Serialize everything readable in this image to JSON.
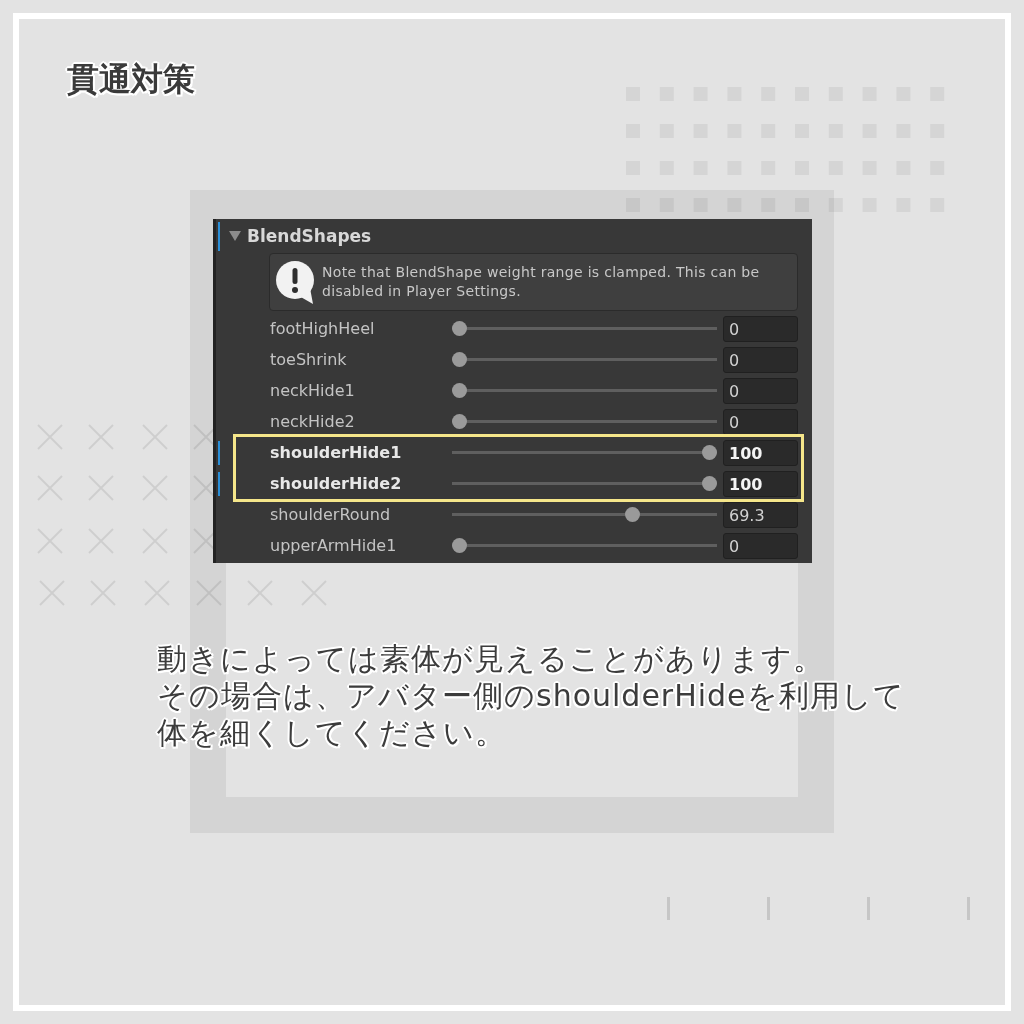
{
  "title": "貫通対策",
  "section": {
    "title": "BlendShapes",
    "expanded": true,
    "overridden": true,
    "notice": "Note that BlendShape weight range is clamped. This can be disabled in Player Settings.",
    "blendshapes": [
      {
        "name": "footHighHeel",
        "level": 0,
        "value": "0",
        "overridden": false,
        "highlighted": false
      },
      {
        "name": "toeShrink",
        "level": 0,
        "value": "0",
        "overridden": false,
        "highlighted": false
      },
      {
        "name": "neckHide1",
        "level": 0,
        "value": "0",
        "overridden": false,
        "highlighted": false
      },
      {
        "name": "neckHide2",
        "level": 0,
        "value": "0",
        "overridden": false,
        "highlighted": false
      },
      {
        "name": "shoulderHide1",
        "level": 1,
        "value": "100",
        "overridden": true,
        "highlighted": true
      },
      {
        "name": "shoulderHide2",
        "level": 1,
        "value": "100",
        "overridden": true,
        "highlighted": true
      },
      {
        "name": "shoulderRound",
        "level": 0.693,
        "value": "69.3",
        "overridden": false,
        "highlighted": false
      },
      {
        "name": "upperArmHide1",
        "level": 0,
        "value": "0",
        "overridden": false,
        "highlighted": false
      }
    ]
  },
  "caption": {
    "lines": [
      "動きによっては素体が見えることがあります。",
      "その場合は、アバター側のshoulderHideを利用して",
      "体を細くしてください。"
    ]
  }
}
